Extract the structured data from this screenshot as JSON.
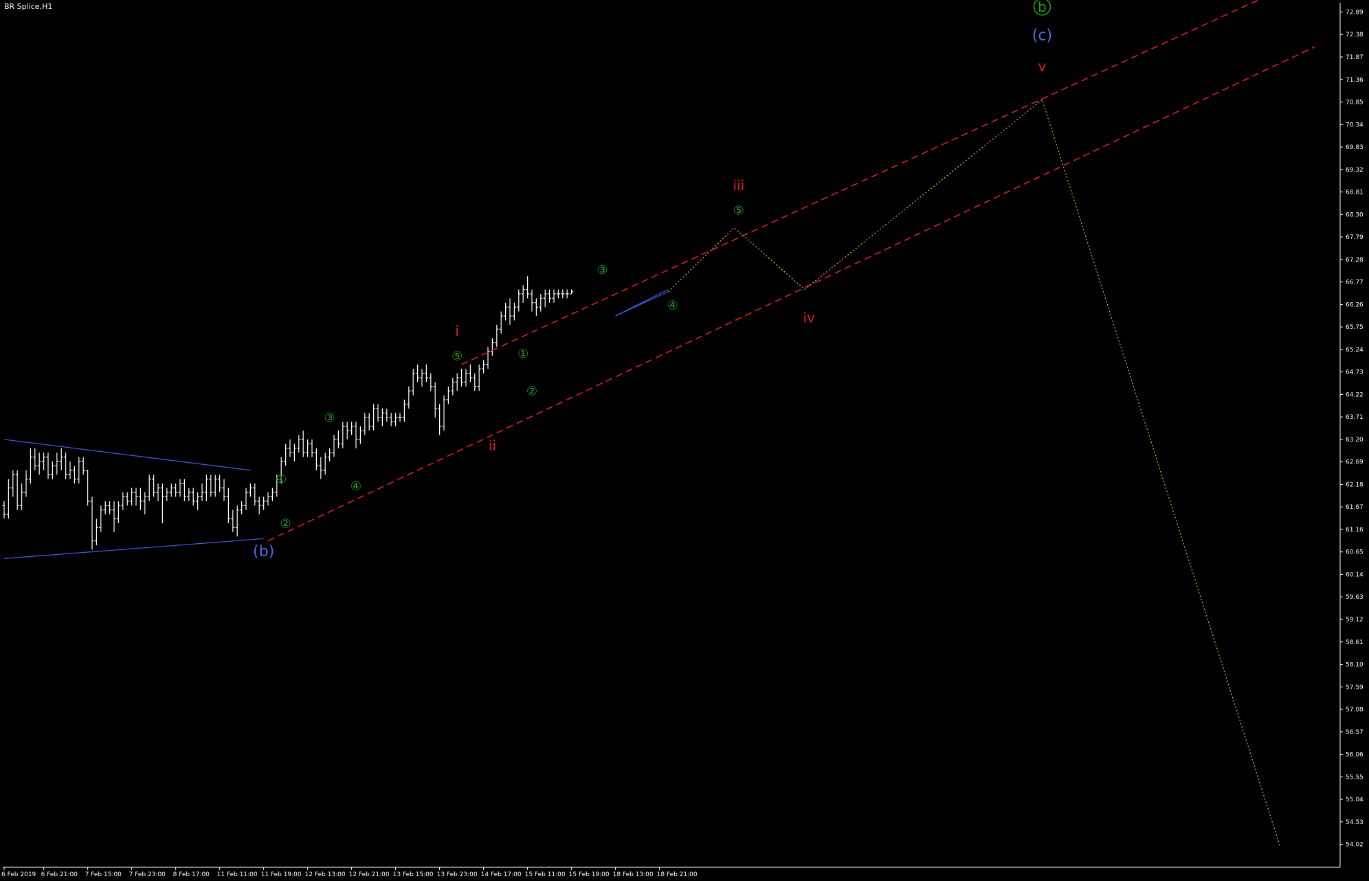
{
  "window": {
    "title": "BR Splice,H1"
  },
  "colors": {
    "background": "#000000",
    "axis": "#ffffff",
    "bars": "#ffffff",
    "bars_bull_accent": "#00c000",
    "channel": "#e02020",
    "triangle": "#4060e8",
    "projection": "#e8c020",
    "wave_red": "#e02020",
    "wave_green": "#20a020",
    "wave_blue": "#5070f0"
  },
  "chart_data": {
    "type": "ohlc",
    "title": "BR Splice,H1",
    "ylim": [
      53.5,
      73.1
    ],
    "y_ticks": [
      "72.89",
      "72.38",
      "71.87",
      "71.36",
      "70.85",
      "70.34",
      "69.83",
      "69.32",
      "68.81",
      "68.30",
      "67.79",
      "67.28",
      "66.77",
      "66.26",
      "65.75",
      "65.24",
      "64.73",
      "64.22",
      "63.71",
      "63.20",
      "62.69",
      "62.18",
      "61.67",
      "61.16",
      "60.65",
      "60.14",
      "59.63",
      "59.12",
      "58.61",
      "58.10",
      "57.59",
      "57.08",
      "56.57",
      "56.06",
      "55.55",
      "55.04",
      "54.53",
      "54.02"
    ],
    "x_ticks": [
      "6 Feb 2019",
      "6 Feb 21:00",
      "7 Feb 15:00",
      "7 Feb 23:00",
      "8 Feb 17:00",
      "11 Feb 11:00",
      "11 Feb 19:00",
      "12 Feb 13:00",
      "12 Feb 21:00",
      "13 Feb 15:00",
      "13 Feb 23:00",
      "14 Feb 17:00",
      "15 Feb 11:00",
      "15 Feb 19:00",
      "18 Feb 13:00",
      "18 Feb 21:00"
    ],
    "x_tick_bar_index": [
      0,
      9,
      19,
      29,
      39,
      49,
      59,
      69,
      79,
      89,
      99,
      109,
      119,
      129,
      139,
      149
    ],
    "bar_spacing_px": 6.4,
    "bars": [
      [
        61.7,
        61.8,
        61.4,
        61.5
      ],
      [
        61.5,
        62.3,
        61.4,
        62.1
      ],
      [
        62.1,
        62.5,
        61.9,
        62.4
      ],
      [
        62.4,
        62.5,
        61.6,
        61.7
      ],
      [
        61.7,
        62.2,
        61.6,
        62.0
      ],
      [
        62.0,
        62.5,
        61.9,
        62.3
      ],
      [
        62.3,
        63.0,
        62.2,
        62.8
      ],
      [
        62.8,
        63.0,
        62.5,
        62.6
      ],
      [
        62.6,
        62.9,
        62.4,
        62.7
      ],
      [
        62.7,
        62.9,
        62.5,
        62.8
      ],
      [
        62.8,
        62.9,
        62.3,
        62.4
      ],
      [
        62.4,
        62.7,
        62.3,
        62.6
      ],
      [
        62.6,
        62.9,
        62.4,
        62.7
      ],
      [
        62.7,
        63.0,
        62.5,
        62.8
      ],
      [
        62.8,
        62.9,
        62.3,
        62.4
      ],
      [
        62.4,
        62.7,
        62.3,
        62.5
      ],
      [
        62.5,
        62.6,
        62.2,
        62.3
      ],
      [
        62.3,
        62.8,
        62.2,
        62.7
      ],
      [
        62.7,
        62.8,
        62.4,
        62.5
      ],
      [
        62.5,
        62.5,
        61.7,
        61.8
      ],
      [
        61.8,
        61.9,
        60.7,
        60.9
      ],
      [
        60.9,
        61.4,
        60.8,
        61.2
      ],
      [
        61.2,
        61.7,
        61.1,
        61.6
      ],
      [
        61.6,
        61.8,
        61.5,
        61.7
      ],
      [
        61.7,
        61.8,
        61.5,
        61.6
      ],
      [
        61.6,
        61.8,
        61.1,
        61.4
      ],
      [
        61.4,
        61.8,
        61.3,
        61.7
      ],
      [
        61.7,
        62.0,
        61.6,
        61.9
      ],
      [
        61.9,
        62.0,
        61.7,
        61.8
      ],
      [
        61.8,
        62.1,
        61.7,
        62.0
      ],
      [
        62.0,
        62.1,
        61.7,
        61.9
      ],
      [
        61.9,
        62.1,
        61.6,
        61.8
      ],
      [
        61.8,
        62.0,
        61.5,
        61.9
      ],
      [
        61.9,
        62.4,
        61.8,
        62.3
      ],
      [
        62.3,
        62.4,
        61.9,
        62.0
      ],
      [
        62.0,
        62.2,
        61.8,
        62.1
      ],
      [
        62.1,
        62.2,
        61.3,
        61.9
      ],
      [
        61.9,
        62.1,
        61.8,
        62.0
      ],
      [
        62.0,
        62.2,
        61.9,
        62.1
      ],
      [
        62.1,
        62.2,
        61.9,
        62.0
      ],
      [
        62.0,
        62.3,
        61.9,
        62.2
      ],
      [
        62.2,
        62.3,
        61.8,
        61.9
      ],
      [
        61.9,
        62.1,
        61.8,
        62.0
      ],
      [
        62.0,
        62.1,
        61.7,
        61.8
      ],
      [
        61.8,
        62.0,
        61.6,
        61.9
      ],
      [
        61.9,
        62.2,
        61.8,
        62.0
      ],
      [
        62.0,
        62.4,
        61.8,
        62.3
      ],
      [
        62.3,
        62.4,
        61.9,
        62.0
      ],
      [
        62.0,
        62.4,
        61.9,
        62.3
      ],
      [
        62.3,
        62.4,
        62.0,
        62.1
      ],
      [
        62.1,
        62.3,
        61.8,
        61.9
      ],
      [
        61.9,
        62.1,
        61.3,
        61.4
      ],
      [
        61.4,
        61.6,
        61.1,
        61.2
      ],
      [
        61.2,
        61.7,
        61.0,
        61.6
      ],
      [
        61.6,
        61.8,
        61.5,
        61.7
      ],
      [
        61.7,
        62.1,
        61.6,
        62.0
      ],
      [
        62.0,
        62.2,
        61.9,
        62.1
      ],
      [
        62.1,
        62.2,
        61.7,
        61.8
      ],
      [
        61.8,
        61.9,
        61.5,
        61.7
      ],
      [
        61.7,
        61.9,
        61.6,
        61.8
      ],
      [
        61.8,
        62.0,
        61.7,
        61.9
      ],
      [
        61.9,
        62.1,
        61.8,
        62.0
      ],
      [
        62.0,
        62.4,
        61.9,
        62.3
      ],
      [
        62.3,
        62.8,
        62.2,
        62.7
      ],
      [
        62.7,
        63.1,
        62.6,
        63.0
      ],
      [
        63.0,
        63.2,
        62.8,
        62.9
      ],
      [
        62.9,
        63.1,
        62.7,
        63.0
      ],
      [
        63.0,
        63.3,
        62.9,
        63.2
      ],
      [
        63.2,
        63.4,
        62.8,
        62.9
      ],
      [
        62.9,
        63.2,
        62.8,
        63.1
      ],
      [
        63.1,
        63.2,
        62.8,
        62.9
      ],
      [
        62.9,
        63.0,
        62.5,
        62.6
      ],
      [
        62.6,
        62.8,
        62.3,
        62.5
      ],
      [
        62.5,
        62.9,
        62.4,
        62.8
      ],
      [
        62.8,
        63.0,
        62.7,
        62.9
      ],
      [
        62.9,
        63.3,
        62.8,
        63.2
      ],
      [
        63.2,
        63.4,
        63.0,
        63.1
      ],
      [
        63.1,
        63.6,
        63.0,
        63.5
      ],
      [
        63.5,
        63.6,
        63.2,
        63.4
      ],
      [
        63.4,
        63.6,
        63.3,
        63.5
      ],
      [
        63.5,
        63.6,
        63.0,
        63.2
      ],
      [
        63.2,
        63.5,
        63.1,
        63.4
      ],
      [
        63.4,
        63.8,
        63.3,
        63.7
      ],
      [
        63.7,
        63.8,
        63.4,
        63.5
      ],
      [
        63.5,
        64.0,
        63.4,
        63.9
      ],
      [
        63.9,
        64.0,
        63.6,
        63.7
      ],
      [
        63.7,
        63.9,
        63.5,
        63.8
      ],
      [
        63.8,
        63.9,
        63.6,
        63.7
      ],
      [
        63.7,
        63.8,
        63.5,
        63.6
      ],
      [
        63.6,
        63.8,
        63.5,
        63.7
      ],
      [
        63.7,
        63.8,
        63.6,
        63.7
      ],
      [
        63.7,
        64.1,
        63.6,
        64.0
      ],
      [
        64.0,
        64.4,
        63.9,
        64.3
      ],
      [
        64.3,
        64.8,
        64.2,
        64.7
      ],
      [
        64.7,
        64.9,
        64.5,
        64.6
      ],
      [
        64.6,
        64.8,
        64.4,
        64.7
      ],
      [
        64.7,
        64.9,
        64.5,
        64.6
      ],
      [
        64.6,
        64.7,
        64.3,
        64.4
      ],
      [
        64.4,
        64.5,
        63.7,
        63.9
      ],
      [
        63.9,
        64.0,
        63.3,
        63.5
      ],
      [
        63.5,
        64.2,
        63.4,
        64.1
      ],
      [
        64.1,
        64.4,
        64.0,
        64.3
      ],
      [
        64.3,
        64.6,
        64.2,
        64.5
      ],
      [
        64.5,
        64.7,
        64.3,
        64.6
      ],
      [
        64.6,
        64.8,
        64.4,
        64.5
      ],
      [
        64.5,
        64.8,
        64.4,
        64.7
      ],
      [
        64.7,
        64.9,
        64.5,
        64.6
      ],
      [
        64.6,
        64.7,
        64.3,
        64.4
      ],
      [
        64.4,
        64.9,
        64.3,
        64.8
      ],
      [
        64.8,
        65.0,
        64.7,
        64.9
      ],
      [
        64.9,
        65.3,
        64.8,
        65.2
      ],
      [
        65.2,
        65.5,
        65.1,
        65.4
      ],
      [
        65.4,
        65.8,
        65.3,
        65.7
      ],
      [
        65.7,
        66.1,
        65.6,
        66.0
      ],
      [
        66.0,
        66.3,
        65.9,
        66.2
      ],
      [
        66.2,
        66.4,
        65.8,
        66.0
      ],
      [
        66.0,
        66.3,
        65.9,
        66.2
      ],
      [
        66.2,
        66.6,
        66.1,
        66.5
      ],
      [
        66.5,
        66.7,
        66.3,
        66.6
      ],
      [
        66.6,
        66.9,
        66.4,
        66.5
      ],
      [
        66.5,
        66.6,
        66.1,
        66.3
      ],
      [
        66.3,
        66.4,
        66.0,
        66.2
      ],
      [
        66.2,
        66.5,
        66.1,
        66.4
      ],
      [
        66.4,
        66.6,
        66.2,
        66.5
      ],
      [
        66.5,
        66.6,
        66.3,
        66.4
      ],
      [
        66.4,
        66.6,
        66.3,
        66.5
      ],
      [
        66.5,
        66.6,
        66.4,
        66.5
      ],
      [
        66.5,
        66.6,
        66.4,
        66.5
      ],
      [
        66.5,
        66.6,
        66.4,
        66.5
      ],
      [
        66.5,
        66.6,
        66.5,
        66.55
      ]
    ],
    "bars_start_x_index": 0,
    "bar_x_scale": 1,
    "channel_lines": [
      {
        "name": "upper-channel",
        "from": [
          104,
          64.9
        ],
        "to": [
          286,
          73.2
        ]
      },
      {
        "name": "lower-channel",
        "from": [
          60,
          60.9
        ],
        "to": [
          298,
          72.1
        ]
      }
    ],
    "triangles": [
      {
        "name": "triangle-left",
        "upper": [
          [
            0,
            63.2
          ],
          [
            56,
            62.5
          ]
        ],
        "lower": [
          [
            0,
            60.5
          ],
          [
            59,
            60.95
          ]
        ]
      },
      {
        "name": "triangle-right",
        "upper": [
          [
            139,
            66.0
          ],
          [
            151,
            66.6
          ]
        ],
        "lower": [
          [
            139,
            66.0
          ],
          [
            151,
            66.55
          ]
        ]
      }
    ],
    "projection_path": [
      [
        151,
        66.55
      ],
      [
        166,
        68.0
      ],
      [
        182,
        66.6
      ],
      [
        236,
        70.9
      ],
      [
        290,
        54.0
      ]
    ],
    "wave_labels": [
      {
        "name": "wave-b-circle",
        "text": "b",
        "circled": true,
        "x": 236,
        "y": 72.9,
        "color": "green"
      },
      {
        "name": "wave-c-paren",
        "text": "(c)",
        "x": 236,
        "y": 72.25,
        "color": "blue"
      },
      {
        "name": "wave-v",
        "text": "v",
        "x": 236,
        "y": 71.55,
        "color": "red"
      },
      {
        "name": "wave-iii",
        "text": "iii",
        "x": 167,
        "y": 68.85,
        "color": "red"
      },
      {
        "name": "wave-5-iii",
        "text": "⑤",
        "x": 167,
        "y": 68.3,
        "color": "green"
      },
      {
        "name": "wave-iv",
        "text": "iv",
        "x": 183,
        "y": 65.85,
        "color": "red"
      },
      {
        "name": "wave-i",
        "text": "i",
        "x": 103,
        "y": 65.55,
        "color": "red"
      },
      {
        "name": "wave-5-i",
        "text": "⑤",
        "x": 103,
        "y": 65.0,
        "color": "green"
      },
      {
        "name": "wave-ii",
        "text": "ii",
        "x": 111,
        "y": 62.95,
        "color": "red"
      },
      {
        "name": "wave-3-top",
        "text": "③",
        "x": 136,
        "y": 66.95,
        "color": "green"
      },
      {
        "name": "wave-4-top",
        "text": "④",
        "x": 152,
        "y": 66.15,
        "color": "green"
      },
      {
        "name": "wave-1-mid",
        "text": "①",
        "x": 118,
        "y": 65.05,
        "color": "green"
      },
      {
        "name": "wave-2-mid",
        "text": "②",
        "x": 120,
        "y": 64.2,
        "color": "green"
      },
      {
        "name": "wave-3-low",
        "text": "③",
        "x": 74,
        "y": 63.6,
        "color": "green"
      },
      {
        "name": "wave-4-low",
        "text": "④",
        "x": 80,
        "y": 62.05,
        "color": "green"
      },
      {
        "name": "wave-1-low",
        "text": "①",
        "x": 63,
        "y": 62.2,
        "color": "green"
      },
      {
        "name": "wave-2-low",
        "text": "②",
        "x": 64,
        "y": 61.2,
        "color": "green"
      },
      {
        "name": "wave-b-paren",
        "text": "(b)",
        "x": 59,
        "y": 60.55,
        "color": "blue"
      }
    ]
  }
}
